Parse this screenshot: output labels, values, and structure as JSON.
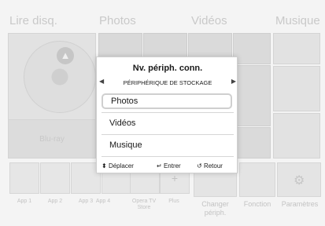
{
  "sections": {
    "disc": "Lire disq.",
    "photos": "Photos",
    "videos": "Vidéos",
    "music": "Musique"
  },
  "disc_tile": {
    "label": "Blu-ray",
    "eject_icon": "eject-icon"
  },
  "apps": {
    "items": [
      "App 1",
      "App 2",
      "App 3",
      "App 4"
    ],
    "opera_line1": "Opera TV",
    "opera_line2": "Store",
    "plus": "Plus",
    "plus_symbol": "+",
    "change_line1": "Changer",
    "change_line2": "périph.",
    "function": "Fonction",
    "settings": "Paramètres",
    "settings_icon": "gear-icon"
  },
  "popup": {
    "title": "Nv. périph. conn.",
    "subtitle": "PÉRIPHÉRIQUE DE STOCKAGE",
    "items": [
      "Photos",
      "Vidéos",
      "Musique"
    ],
    "selected_index": 0,
    "footer": {
      "move": "Déplacer",
      "enter": "Entrer",
      "back": "Retour"
    }
  }
}
